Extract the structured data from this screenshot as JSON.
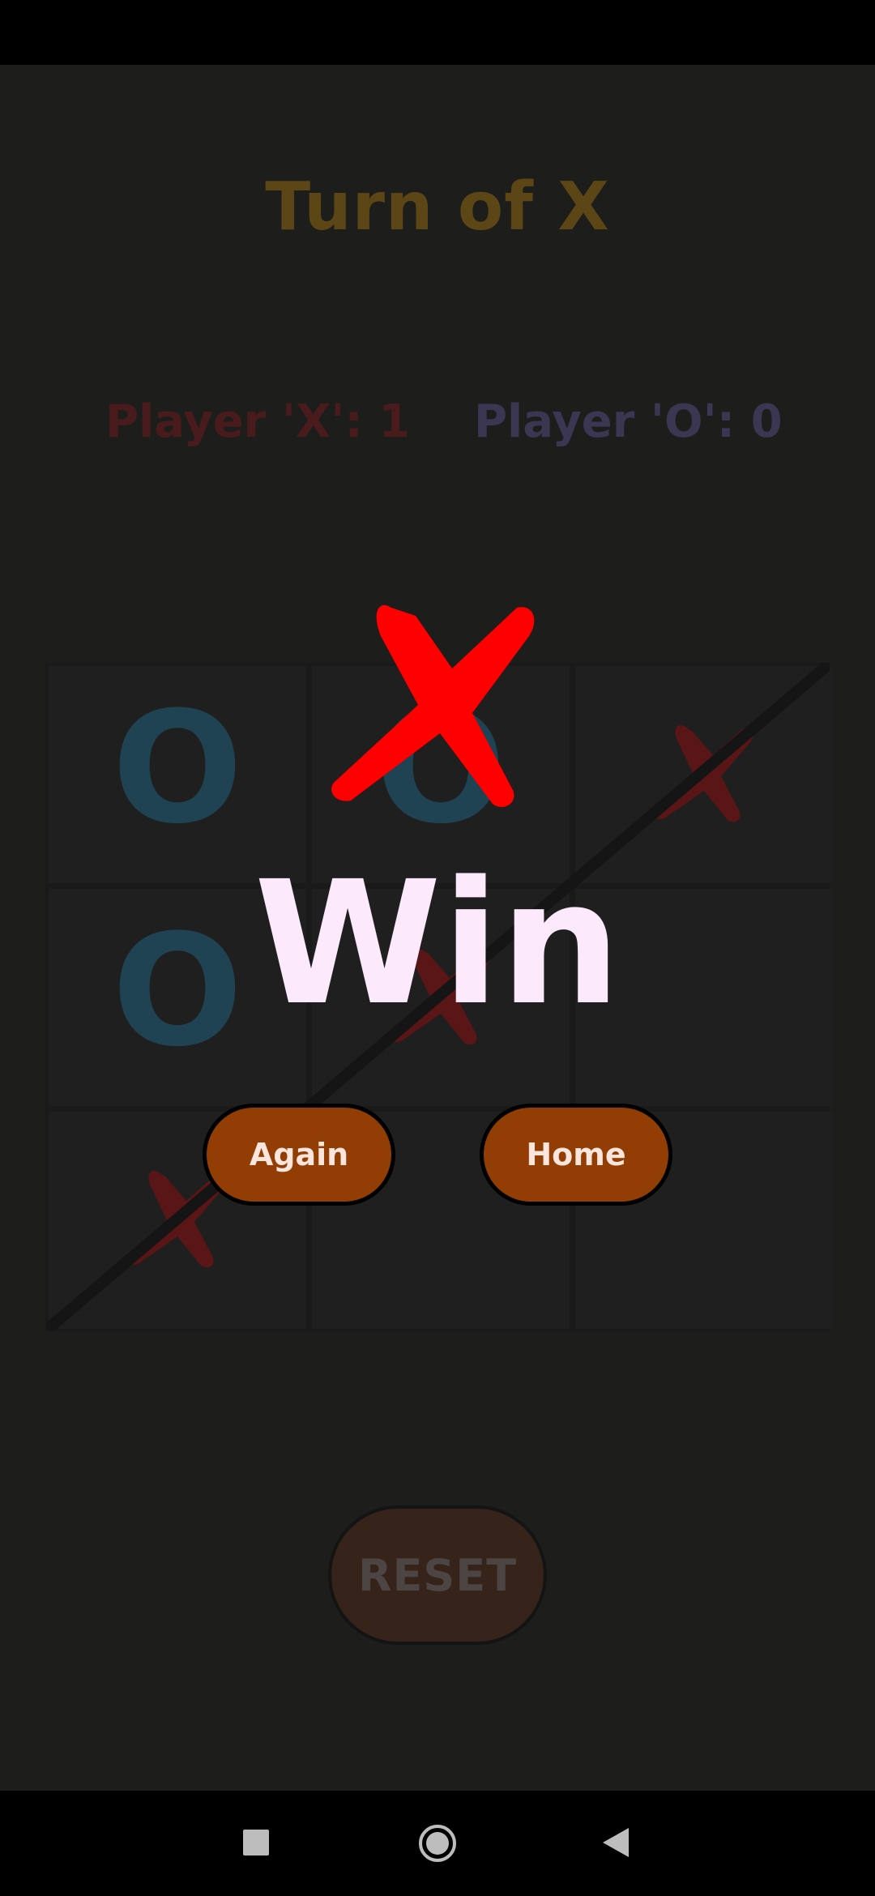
{
  "header": {
    "turn_text": "Turn of X"
  },
  "scores": {
    "x_label": "Player 'X': 1",
    "o_label": "Player 'O': 0"
  },
  "board": {
    "cells": [
      [
        "O",
        "O",
        "X"
      ],
      [
        "O",
        "X",
        ""
      ],
      [
        "X",
        "",
        ""
      ]
    ],
    "winning_line": "diagonal from bottom-left to top-right"
  },
  "result": {
    "winner_icon": "x-mark-icon",
    "text": "Win"
  },
  "buttons": {
    "again_label": "Again",
    "home_label": "Home",
    "reset_label": "RESET"
  },
  "colors": {
    "background": "#1d1e1c",
    "x_color": "#ff0000",
    "o_color": "#1f4353",
    "button": "#923d03",
    "win_text": "#fce9fb"
  },
  "navigation": {
    "recents": "recents-icon",
    "home": "home-circle-icon",
    "back": "back-triangle-icon"
  }
}
